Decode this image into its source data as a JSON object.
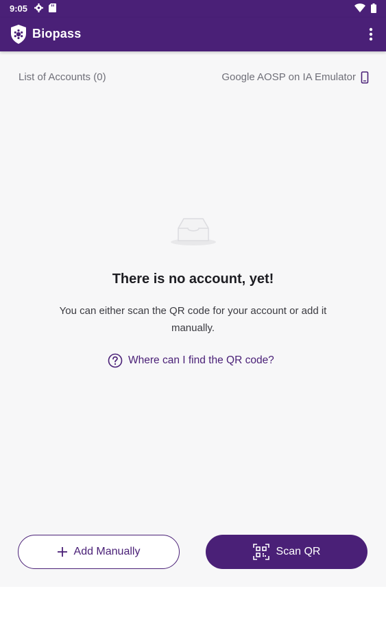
{
  "status_bar": {
    "time": "9:05",
    "icons": [
      "settings-icon",
      "sd-card-icon",
      "wifi-icon",
      "battery-icon"
    ]
  },
  "app_bar": {
    "title": "Biopass",
    "logo": "shield-logo-icon",
    "menu_icon": "more-vert-icon"
  },
  "subheader": {
    "accounts_label": "List of Accounts (0)",
    "device_label": "Google AOSP on IA Emulator",
    "device_icon": "smartphone-icon"
  },
  "empty_state": {
    "illustration": "empty-inbox-icon",
    "title": "There is no account, yet!",
    "description": "You can either scan the QR code for your account or add it manually.",
    "help_link": "Where can I find the QR code?",
    "help_icon": "help-circle-icon"
  },
  "actions": {
    "add_manually": "Add Manually",
    "scan_qr": "Scan QR"
  },
  "colors": {
    "brand": "#4a2077",
    "background": "#f7f7f8",
    "text_primary": "#1d1d22",
    "text_secondary": "#6f6f78"
  }
}
